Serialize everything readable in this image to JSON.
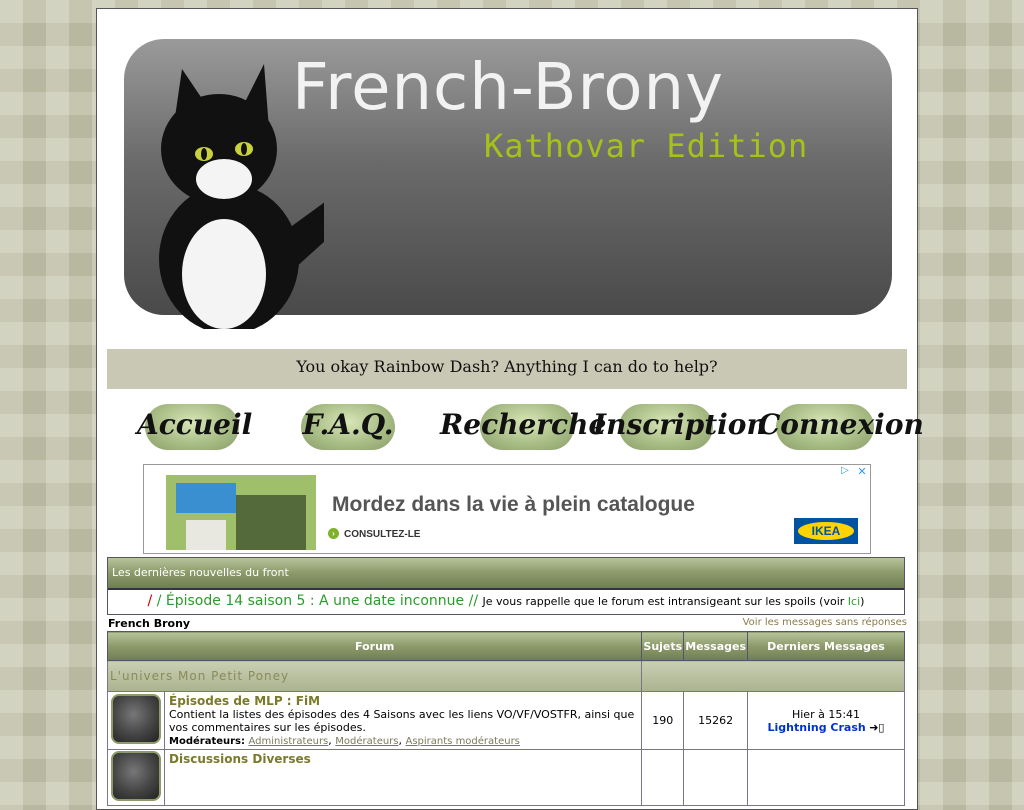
{
  "banner": {
    "title": "French-Brony",
    "subtitle": "Kathovar Edition"
  },
  "quote": "You okay Rainbow Dash? Anything I can do to help?",
  "nav": {
    "home": "Accueil",
    "faq": "F.A.Q.",
    "search": "Recherche",
    "register": "Inscription",
    "login": "Connexion"
  },
  "ad": {
    "headline": "Mordez dans la vie à plein catalogue",
    "cta": "CONSULTEZ-LE",
    "brand": "IKEA"
  },
  "news": {
    "header": "Les dernières nouvelles du front",
    "slash": "/",
    "ticker": " / Épisode 14 saison 5 : A une date inconnue // ",
    "message_pre": "Je vous rappelle que le forum est intransigeant sur les spoils (voir ",
    "link": "Ici",
    "message_post": ")"
  },
  "forum": {
    "name": "French Brony",
    "unanswered": "Voir les messages sans réponses",
    "columns": {
      "forum": "Forum",
      "topics": "Sujets",
      "messages": "Messages",
      "last": "Derniers Messages"
    },
    "category": "L'univers Mon Petit Poney",
    "rows": [
      {
        "title": "Épisodes de MLP : FiM",
        "desc": "Contient la listes des épisodes des 4 Saisons avec les liens VO/VF/VOSTFR, ainsi que vos commentaires sur les épisodes.",
        "mod_label": "Modérateurs:",
        "mods": [
          "Administrateurs",
          "Modérateurs",
          "Aspirants modérateurs"
        ],
        "topics": "190",
        "messages": "15262",
        "last_time": "Hier à 15:41",
        "last_user": "Lightning Crash"
      },
      {
        "title": "Discussions Diverses"
      }
    ]
  }
}
